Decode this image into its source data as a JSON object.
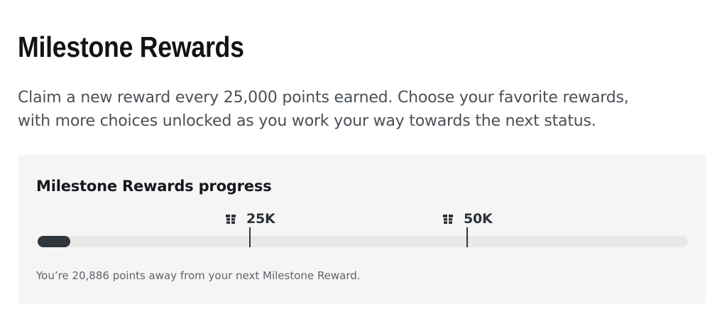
{
  "header": {
    "title": "Milestone Rewards",
    "intro_line1": "Claim a new reward every 25,000 points earned. Choose your favorite rewards,",
    "intro_line2": "with more choices unlocked as you work your way towards the next status."
  },
  "progress_card": {
    "title": "Milestone Rewards progress",
    "milestones": [
      {
        "label": "25K",
        "icon": "gift-icon"
      },
      {
        "label": "50K",
        "icon": "gift-icon"
      }
    ],
    "progress_fraction": 0.05,
    "message": "You’re 20,886 points away from your next Milestone Reward."
  },
  "colors": {
    "card_background": "#f5f5f5",
    "track": "#e8e8e8",
    "fill": "#2f363c"
  }
}
